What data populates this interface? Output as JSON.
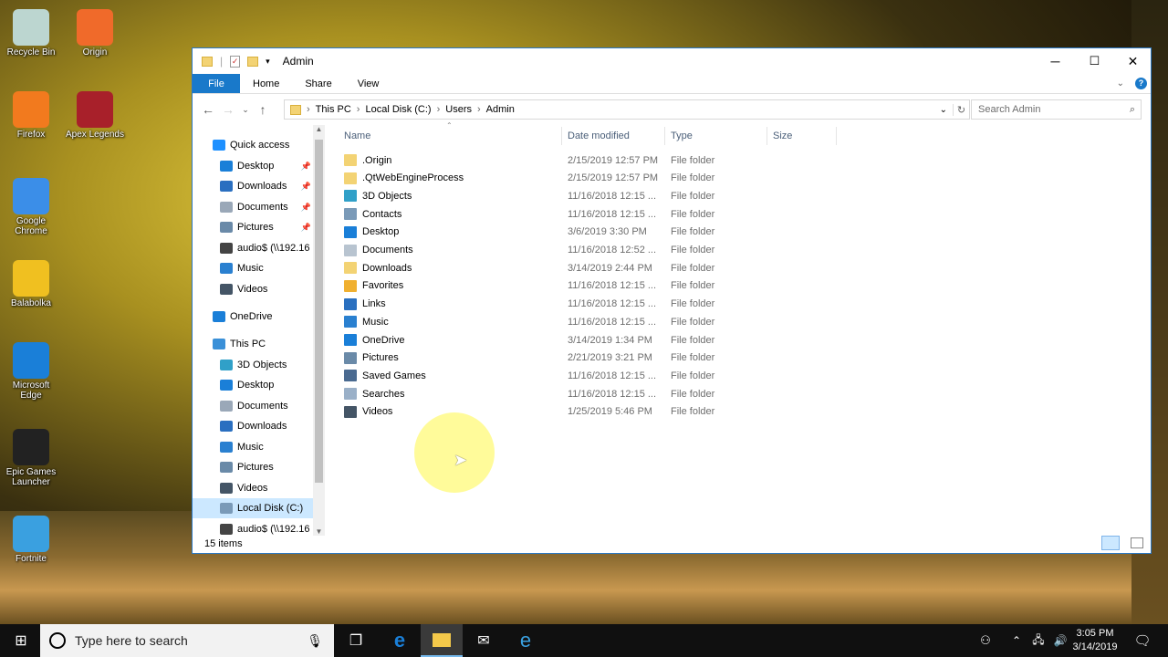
{
  "desktop": {
    "icons": [
      {
        "label": "Recycle Bin",
        "color": "#bcd6d0"
      },
      {
        "label": "Origin",
        "color": "#f06a2a"
      },
      {
        "label": "Firefox",
        "color": "#f27a1e"
      },
      {
        "label": "Apex Legends",
        "color": "#a8202a"
      },
      {
        "label": "Google Chrome",
        "color": "#3b8ee8"
      },
      {
        "label": "Balabolka",
        "color": "#f0c020"
      },
      {
        "label": "Microsoft Edge",
        "color": "#1a7fd8"
      },
      {
        "label": "Epic Games Launcher",
        "color": "#222222"
      },
      {
        "label": "Fortnite",
        "color": "#3aa0e0"
      }
    ]
  },
  "window": {
    "title": "Admin",
    "controls": {
      "minimize": "─",
      "maximize": "☐",
      "close": "✕"
    },
    "ribbon_tabs": [
      "File",
      "Home",
      "Share",
      "View"
    ],
    "breadcrumb": [
      "This PC",
      "Local Disk (C:)",
      "Users",
      "Admin"
    ],
    "search_placeholder": "Search Admin",
    "columns": [
      "Name",
      "Date modified",
      "Type",
      "Size"
    ],
    "status": "15 items"
  },
  "nav": [
    {
      "label": "Quick access",
      "icon": "star-icon",
      "color": "#1e90ff",
      "level": 0
    },
    {
      "label": "Desktop",
      "icon": "desktop-icon",
      "color": "#1a7fd8",
      "level": 1,
      "pinned": true
    },
    {
      "label": "Downloads",
      "icon": "download-icon",
      "color": "#2a6fc0",
      "level": 1,
      "pinned": true
    },
    {
      "label": "Documents",
      "icon": "document-icon",
      "color": "#9aa8b8",
      "level": 1,
      "pinned": true
    },
    {
      "label": "Pictures",
      "icon": "picture-icon",
      "color": "#6a8aa8",
      "level": 1,
      "pinned": true
    },
    {
      "label": "audio$ (\\\\192.16",
      "icon": "network-drive-icon",
      "color": "#444444",
      "level": 1
    },
    {
      "label": "Music",
      "icon": "music-icon",
      "color": "#2a80d0",
      "level": 1
    },
    {
      "label": "Videos",
      "icon": "video-icon",
      "color": "#445566",
      "level": 1
    },
    {
      "label": "OneDrive",
      "icon": "cloud-icon",
      "color": "#1a7fd8",
      "level": 0
    },
    {
      "label": "This PC",
      "icon": "computer-icon",
      "color": "#3a90d8",
      "level": 0
    },
    {
      "label": "3D Objects",
      "icon": "cube-icon",
      "color": "#30a0c8",
      "level": 1
    },
    {
      "label": "Desktop",
      "icon": "desktop-icon",
      "color": "#1a7fd8",
      "level": 1
    },
    {
      "label": "Documents",
      "icon": "document-icon",
      "color": "#9aa8b8",
      "level": 1
    },
    {
      "label": "Downloads",
      "icon": "download-icon",
      "color": "#2a6fc0",
      "level": 1
    },
    {
      "label": "Music",
      "icon": "music-icon",
      "color": "#2a80d0",
      "level": 1
    },
    {
      "label": "Pictures",
      "icon": "picture-icon",
      "color": "#6a8aa8",
      "level": 1
    },
    {
      "label": "Videos",
      "icon": "video-icon",
      "color": "#445566",
      "level": 1
    },
    {
      "label": "Local Disk (C:)",
      "icon": "drive-icon",
      "color": "#7a9ab8",
      "level": 1,
      "selected": true
    },
    {
      "label": "audio$ (\\\\192.16",
      "icon": "network-drive-icon",
      "color": "#444444",
      "level": 1
    }
  ],
  "files": [
    {
      "name": ".Origin",
      "date": "2/15/2019 12:57 PM",
      "type": "File folder",
      "color": "#f3d374"
    },
    {
      "name": ".QtWebEngineProcess",
      "date": "2/15/2019 12:57 PM",
      "type": "File folder",
      "color": "#f3d374"
    },
    {
      "name": "3D Objects",
      "date": "11/16/2018 12:15 ...",
      "type": "File folder",
      "color": "#30a0c8"
    },
    {
      "name": "Contacts",
      "date": "11/16/2018 12:15 ...",
      "type": "File folder",
      "color": "#7a9ab8"
    },
    {
      "name": "Desktop",
      "date": "3/6/2019 3:30 PM",
      "type": "File folder",
      "color": "#1a7fd8"
    },
    {
      "name": "Documents",
      "date": "11/16/2018 12:52 ...",
      "type": "File folder",
      "color": "#b8c4d0"
    },
    {
      "name": "Downloads",
      "date": "3/14/2019 2:44 PM",
      "type": "File folder",
      "color": "#f3d374"
    },
    {
      "name": "Favorites",
      "date": "11/16/2018 12:15 ...",
      "type": "File folder",
      "color": "#f0b030"
    },
    {
      "name": "Links",
      "date": "11/16/2018 12:15 ...",
      "type": "File folder",
      "color": "#2a70c0"
    },
    {
      "name": "Music",
      "date": "11/16/2018 12:15 ...",
      "type": "File folder",
      "color": "#2a80d0"
    },
    {
      "name": "OneDrive",
      "date": "3/14/2019 1:34 PM",
      "type": "File folder",
      "color": "#1a7fd8"
    },
    {
      "name": "Pictures",
      "date": "2/21/2019 3:21 PM",
      "type": "File folder",
      "color": "#6a8aa8"
    },
    {
      "name": "Saved Games",
      "date": "11/16/2018 12:15 ...",
      "type": "File folder",
      "color": "#4a6a90"
    },
    {
      "name": "Searches",
      "date": "11/16/2018 12:15 ...",
      "type": "File folder",
      "color": "#9ab0c8"
    },
    {
      "name": "Videos",
      "date": "1/25/2019 5:46 PM",
      "type": "File folder",
      "color": "#445566"
    }
  ],
  "taskbar": {
    "search_placeholder": "Type here to search",
    "time": "3:05 PM",
    "date": "3/14/2019"
  }
}
